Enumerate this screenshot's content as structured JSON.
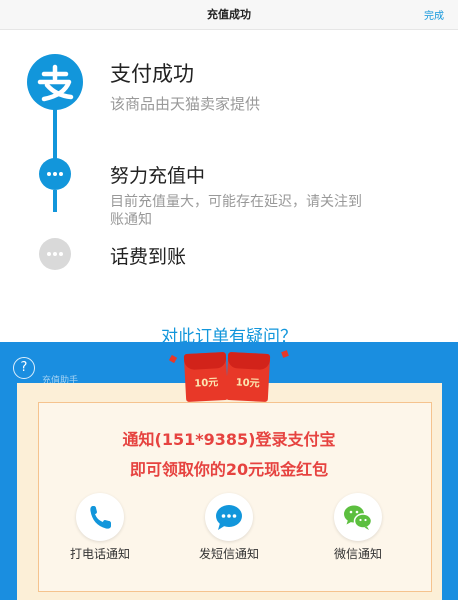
{
  "nav": {
    "title": "充值成功",
    "done": "完成"
  },
  "steps": [
    {
      "title": "支付成功",
      "desc": "该商品由天猫卖家提供",
      "status": "done"
    },
    {
      "title": "努力充值中",
      "desc_line1": "目前充值量大，可能存在延迟，请关注到",
      "desc_line2": "账通知",
      "status": "active"
    },
    {
      "title": "话费到账",
      "status": "pending"
    }
  ],
  "question_link": "对此订单有疑问？",
  "overlay": {
    "help_glyph": "?",
    "help_label": "充值助手",
    "envelopes": [
      "10元",
      "10元"
    ],
    "promo_line1": "通知(151*9385)登录支付宝",
    "promo_line2": "即可领取你的20元现金红包",
    "actions": [
      {
        "label": "打电话通知",
        "icon": "phone-icon"
      },
      {
        "label": "发短信通知",
        "icon": "sms-icon"
      },
      {
        "label": "微信通知",
        "icon": "wechat-icon"
      }
    ]
  },
  "colors": {
    "primary": "#1296db",
    "overlay": "#1a8ee0",
    "promo": "#e64340",
    "envelope": "#e83828",
    "wechat": "#5cbf3f"
  }
}
